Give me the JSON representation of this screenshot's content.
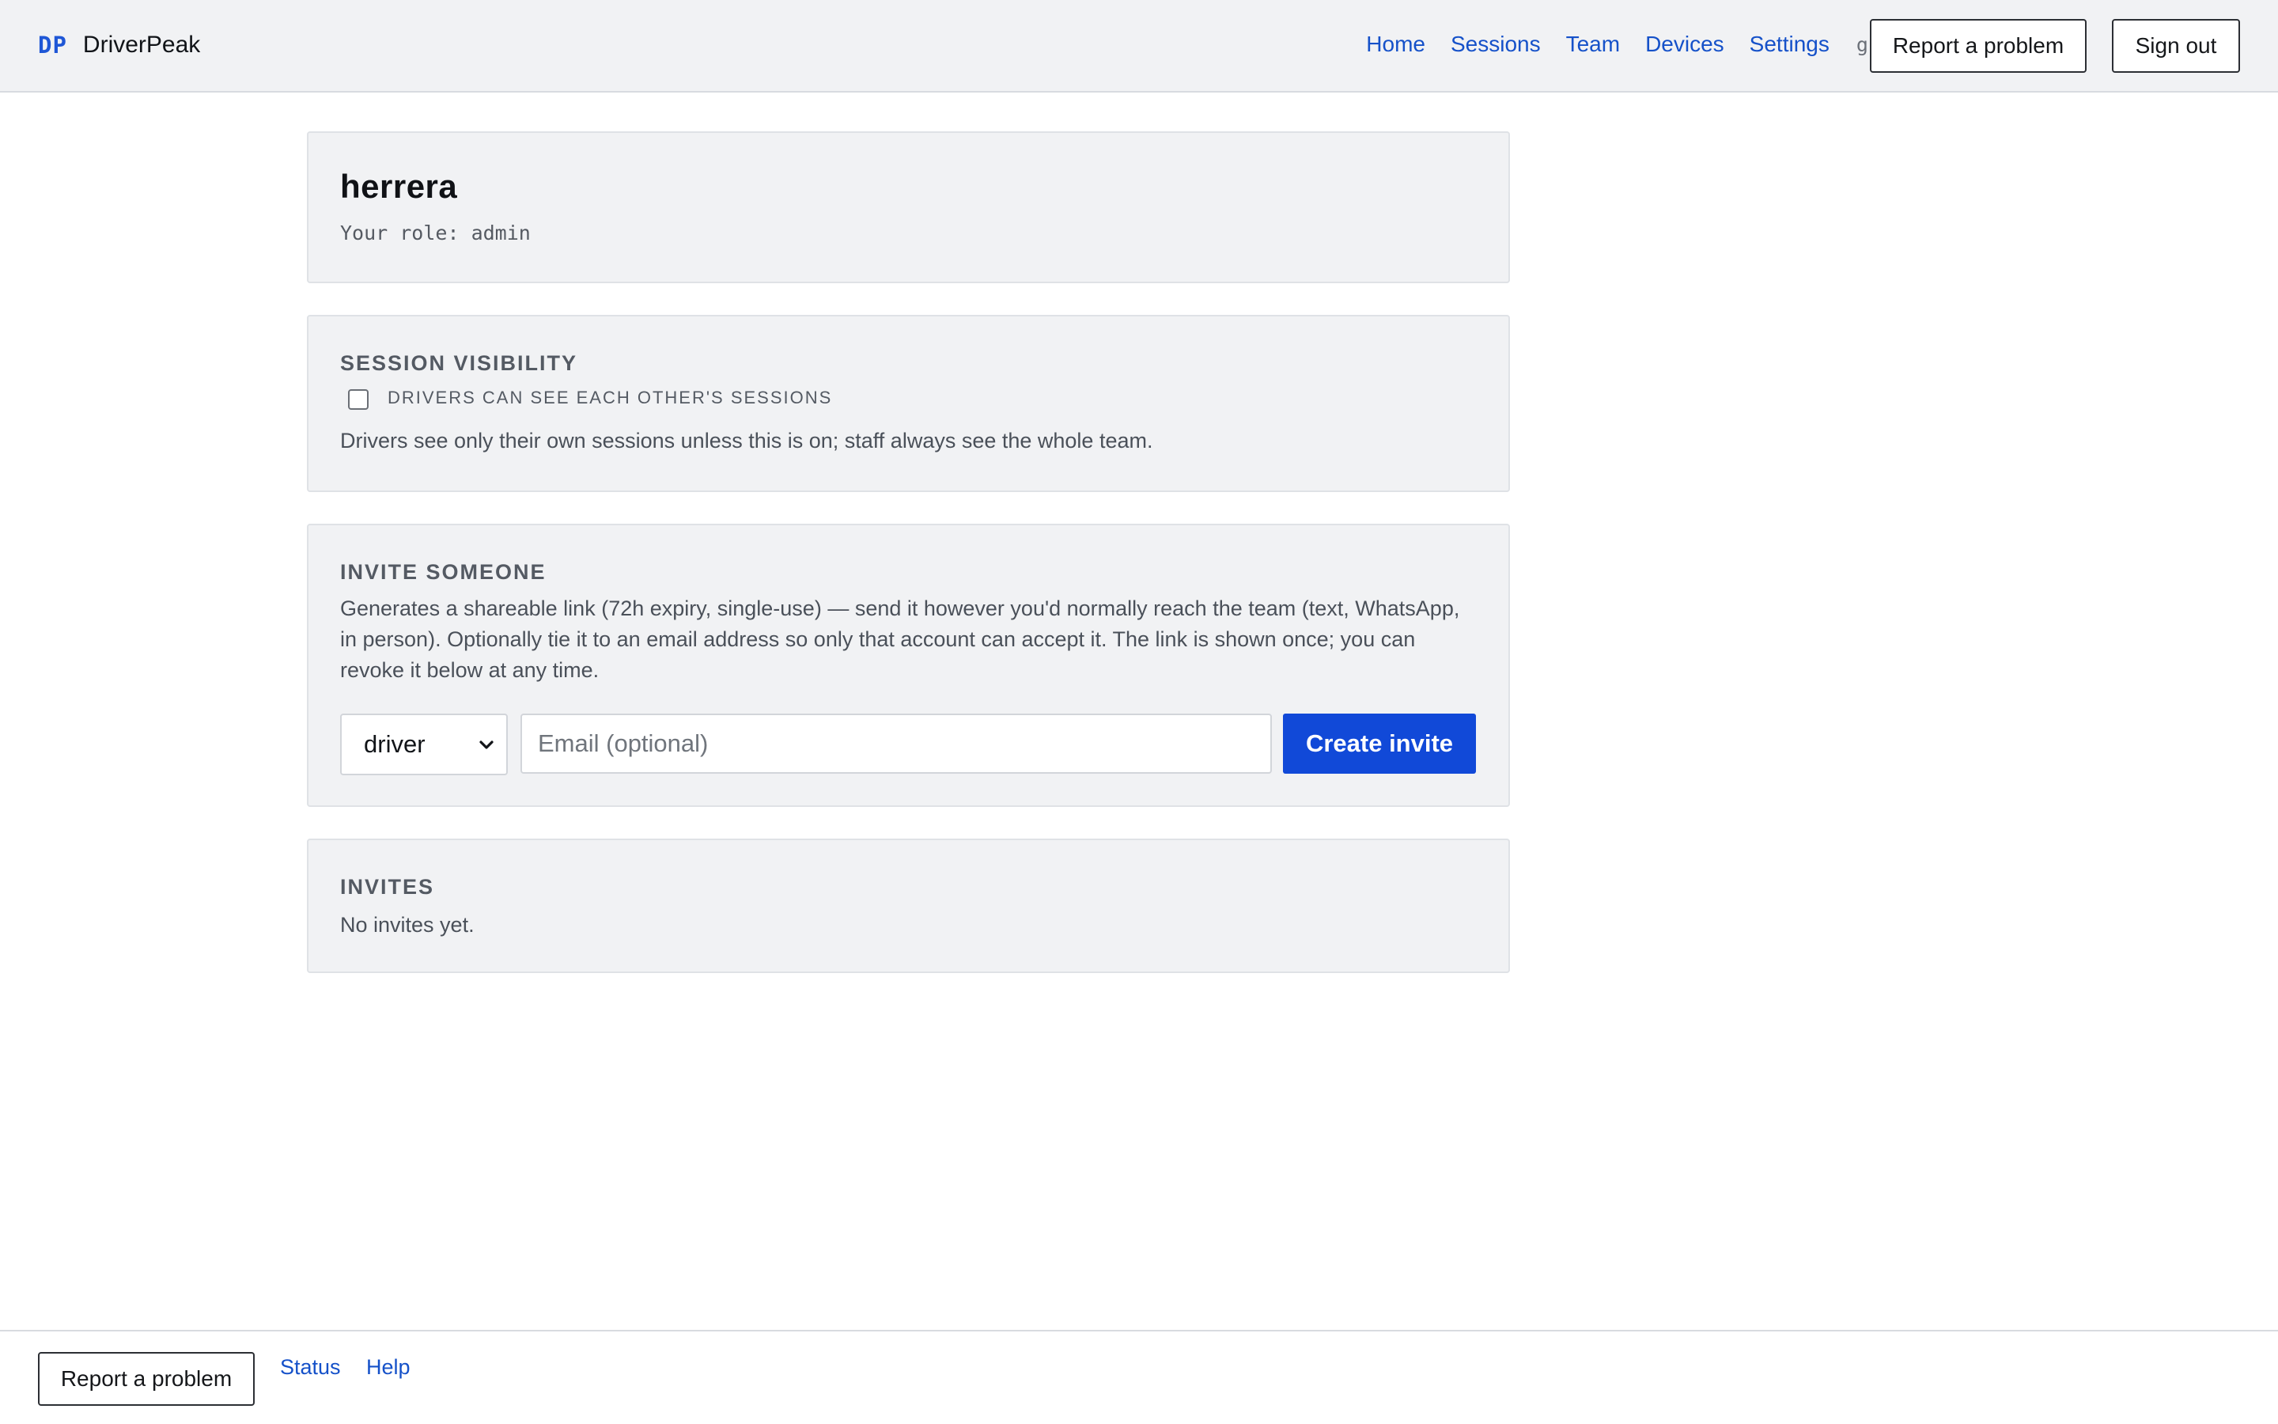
{
  "header": {
    "brand_mark": "DP",
    "brand_name": "DriverPeak",
    "nav": [
      "Home",
      "Sessions",
      "Team",
      "Devices",
      "Settings"
    ],
    "user": "gil",
    "report_label": "Report a problem",
    "signout_label": "Sign out"
  },
  "team": {
    "name": "herrera",
    "role_text": "Your role: admin"
  },
  "visibility": {
    "title": "SESSION VISIBILITY",
    "checkbox_label": "DRIVERS CAN SEE EACH OTHER'S SESSIONS",
    "checked": false,
    "help": "Drivers see only their own sessions unless this is on; staff always see the whole team."
  },
  "invite": {
    "title": "INVITE SOMEONE",
    "description": "Generates a shareable link (72h expiry, single-use) — send it however you'd normally reach the team (text, WhatsApp, in person). Optionally tie it to an email address so only that account can accept it. The link is shown once; you can revoke it below at any time.",
    "role_selected": "driver",
    "email_placeholder": "Email (optional)",
    "create_label": "Create invite"
  },
  "invites": {
    "title": "INVITES",
    "empty": "No invites yet."
  },
  "footer": {
    "report_label": "Report a problem",
    "status_label": "Status",
    "help_label": "Help"
  },
  "colors": {
    "accent": "#1149d8",
    "link": "#1551c9",
    "card_bg": "#f1f2f4"
  },
  "icons": {
    "select_chevron": "chevron-down-icon"
  }
}
